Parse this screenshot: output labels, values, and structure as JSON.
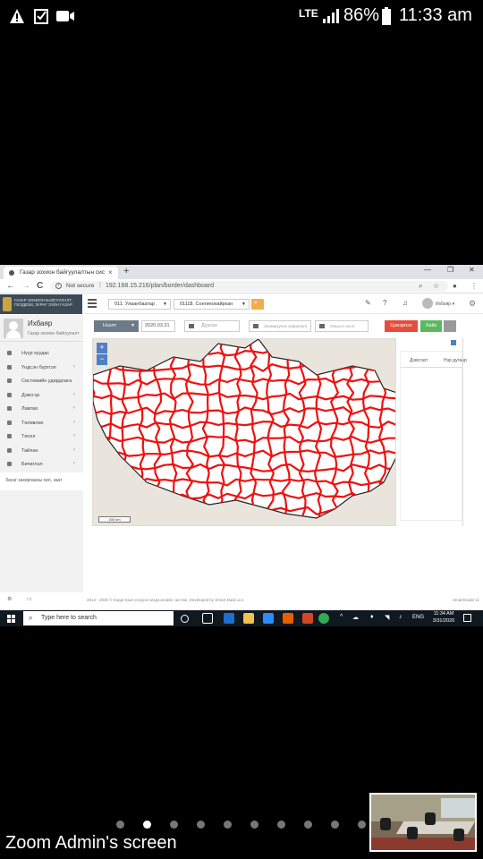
{
  "phone_status": {
    "network": "LTE",
    "battery_percent": "86%",
    "time": "11:33 am",
    "icons": [
      "warning-notification-icon",
      "checkbox-notification-icon",
      "video-camera-icon",
      "signal-icon",
      "battery-icon"
    ]
  },
  "browser": {
    "tab_title": "Газар зохион байгуулалтын сис",
    "tab_close": "×",
    "new_tab": "+",
    "security_label": "Not secure",
    "url": "192.168.15.216/plan/border/dashboard",
    "nav": {
      "back": "←",
      "forward": "→",
      "reload": "C"
    }
  },
  "app": {
    "logo_text": "ГАЗАР ЗОХИОН БАЙГУУЛАЛТ, ГЕОДЕЗИ, ЗУРАГ ЗҮЙН ГАЗАР",
    "org_select": "011. Улаанбаатар",
    "branch_select": "01118. Сонгинохайрхан",
    "user_menu": "Ихбаяр ▾",
    "profile": {
      "name": "Ихбаяр",
      "role": "Газар зохион байгуулалт"
    },
    "menu": [
      {
        "label": "Нүүр хуудас",
        "arrow": ""
      },
      {
        "label": "Үндсэн бүртгэл",
        "arrow": "‹"
      },
      {
        "label": "Системийн удирдлага",
        "arrow": ""
      },
      {
        "label": "Дэвсгэр",
        "arrow": "‹"
      },
      {
        "label": "Лавлах",
        "arrow": "‹"
      },
      {
        "label": "Төлөвлөх",
        "arrow": "‹"
      },
      {
        "label": "Төсөл",
        "arrow": "‹"
      },
      {
        "label": "Тайлан",
        "arrow": "‹"
      },
      {
        "label": "Бичиглэл",
        "arrow": "‹"
      }
    ],
    "note": "Засаг захиргааны хил, заат",
    "toolbar": {
      "layer_button": "Нээлт",
      "date": "2020.03.31",
      "end_date_placeholder": "Дуусах",
      "filter_1": "Эзэмшүүлэх зориулалт",
      "filter_2": "Онцлог хэсэг",
      "clear_button": "Цэвэрлэх",
      "search_button": "Хайх"
    },
    "map": {
      "zoom_in": "+",
      "zoom_out": "−",
      "scale": "200 km"
    },
    "panel_headers": [
      "Дэвсгэрт",
      "Нэр дугаар"
    ],
    "footer_copyright": "2014 - 2020 © Кадастрын нэгдсэн мэдээллийн систем. Developed by Smart Data LLC",
    "footer_brand": "SmartGuide v1"
  },
  "taskbar": {
    "search_placeholder": "Type here to search",
    "language": "ENG",
    "time": "11:34 AM",
    "date": "3/31/2020"
  },
  "zoom": {
    "label": "Zoom Admin's screen",
    "dots_total": 10,
    "active_dot": 1
  },
  "colors": {
    "border_lines": "#ee1111",
    "primary": "#4f7fc4",
    "danger": "#e74c3c",
    "success": "#5cb85c",
    "warning": "#f0ad4e"
  }
}
